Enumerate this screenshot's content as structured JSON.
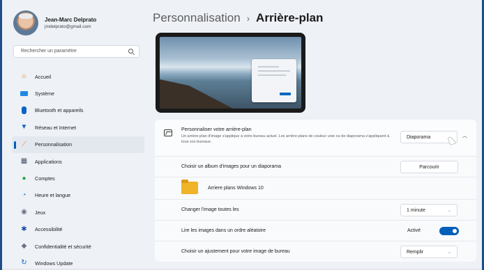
{
  "user": {
    "name": "Jean-Marc Delprato",
    "email": "jmdelprato@gmail.com"
  },
  "search": {
    "placeholder": "Rechercher un paramètre"
  },
  "nav": [
    {
      "label": "Accueil",
      "icon": "home-icon",
      "color": "#d97706"
    },
    {
      "label": "Système",
      "icon": "monitor-icon",
      "color": "#1e88e5"
    },
    {
      "label": "Bluetooth et appareils",
      "icon": "bluetooth-icon",
      "color": "#0a64c8"
    },
    {
      "label": "Réseau et Internet",
      "icon": "wifi-icon",
      "color": "#1565c0"
    },
    {
      "label": "Personnalisation",
      "icon": "paintbrush-icon",
      "color": "#ef7d1a",
      "active": true
    },
    {
      "label": "Applications",
      "icon": "apps-icon",
      "color": "#4a5568"
    },
    {
      "label": "Comptes",
      "icon": "person-icon",
      "color": "#27a844"
    },
    {
      "label": "Heure et langue",
      "icon": "globe-clock-icon",
      "color": "#1976d2"
    },
    {
      "label": "Jeux",
      "icon": "gamepad-icon",
      "color": "#6b7280"
    },
    {
      "label": "Accessibilité",
      "icon": "accessibility-icon",
      "color": "#1b4fa8"
    },
    {
      "label": "Confidentialité et sécurité",
      "icon": "shield-icon",
      "color": "#6b7280"
    },
    {
      "label": "Windows Update",
      "icon": "update-icon",
      "color": "#0a64c8"
    }
  ],
  "breadcrumb": {
    "parent": "Personnalisation",
    "separator": "›",
    "current": "Arrière-plan"
  },
  "background": {
    "title": "Personnaliser votre arrière-plan",
    "description": "Un arrière-plan d'image s'applique à votre bureau actuel. Les arrière-plans de couleur unie ou de diaporama s'appliquent à tous vos bureaux.",
    "type_value": "Diaporama",
    "album_label": "Choisir un album d'images pour un diaporama",
    "browse_label": "Parcourir",
    "folder_name": "Arriere plans Windows 10",
    "interval_label": "Changer l'image toutes les",
    "interval_value": "1 minute",
    "shuffle_label": "Lire les images dans un ordre aléatoire",
    "shuffle_state": "Activé",
    "shuffle_on": true,
    "fit_label": "Choisir un ajustement pour votre image de bureau",
    "fit_value": "Remplir"
  },
  "accent_color": "#005fb8"
}
